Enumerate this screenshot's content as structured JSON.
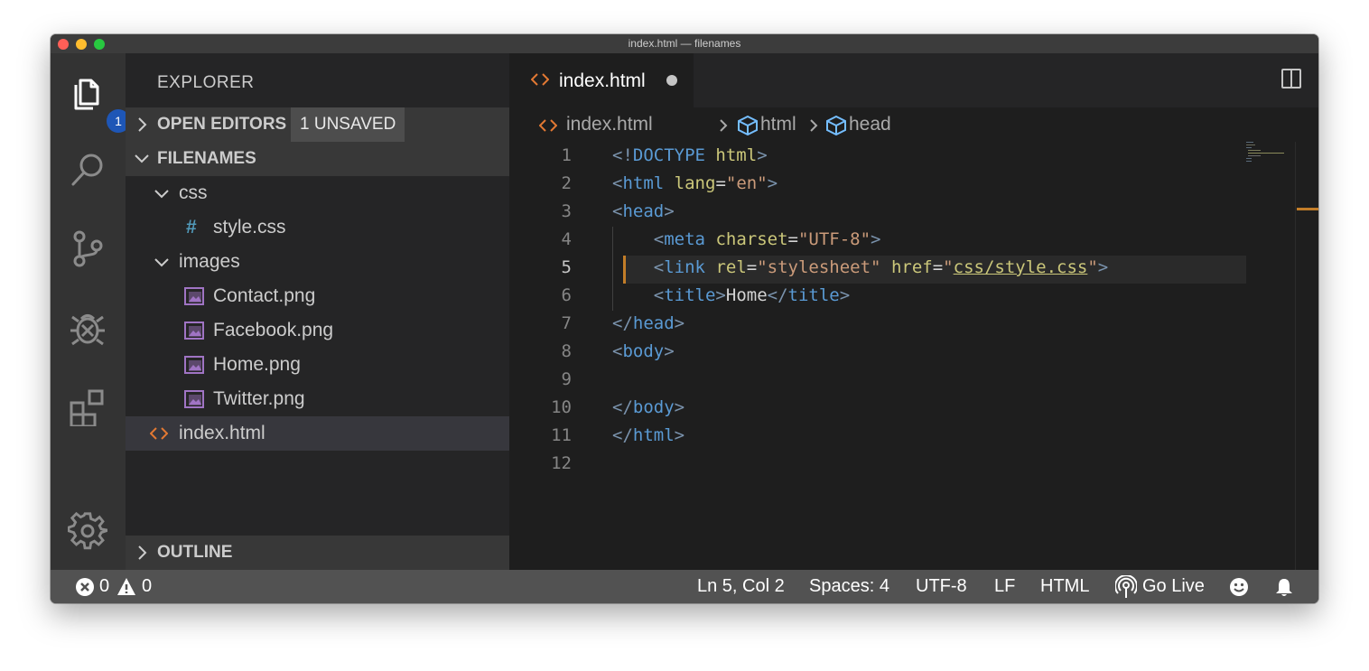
{
  "window": {
    "title": "index.html — filenames"
  },
  "activity_bar": {
    "badge": "1"
  },
  "sidebar": {
    "title": "EXPLORER",
    "open_editors": {
      "label": "OPEN EDITORS",
      "unsaved": "1 UNSAVED"
    },
    "folder": {
      "label": "FILENAMES"
    },
    "tree": [
      {
        "label": "css",
        "type": "folder"
      },
      {
        "label": "style.css",
        "type": "css",
        "icon_glyph": "#"
      },
      {
        "label": "images",
        "type": "folder"
      },
      {
        "label": "Contact.png",
        "type": "image"
      },
      {
        "label": "Facebook.png",
        "type": "image"
      },
      {
        "label": "Home.png",
        "type": "image"
      },
      {
        "label": "Twitter.png",
        "type": "image"
      },
      {
        "label": "index.html",
        "type": "html",
        "selected": true
      }
    ],
    "outline": {
      "label": "OUTLINE"
    }
  },
  "editor": {
    "tab": {
      "label": "index.html",
      "dirty": true
    },
    "breadcrumbs": [
      "index.html",
      "html",
      "head"
    ],
    "lines": [
      {
        "n": "1",
        "indent": "",
        "tokens": [
          {
            "t": "<!",
            "c": "tg"
          },
          {
            "t": "DOCTYPE",
            "c": "tn"
          },
          {
            "t": " ",
            "c": "pl"
          },
          {
            "t": "html",
            "c": "at"
          },
          {
            "t": ">",
            "c": "tg"
          }
        ]
      },
      {
        "n": "2",
        "indent": "",
        "tokens": [
          {
            "t": "<",
            "c": "tg"
          },
          {
            "t": "html",
            "c": "tn"
          },
          {
            "t": " ",
            "c": "pl"
          },
          {
            "t": "lang",
            "c": "at"
          },
          {
            "t": "=",
            "c": "pl"
          },
          {
            "t": "\"en\"",
            "c": "av"
          },
          {
            "t": ">",
            "c": "tg"
          }
        ]
      },
      {
        "n": "3",
        "indent": "",
        "tokens": [
          {
            "t": "<",
            "c": "tg"
          },
          {
            "t": "head",
            "c": "tn"
          },
          {
            "t": ">",
            "c": "tg"
          }
        ]
      },
      {
        "n": "4",
        "indent": "    ",
        "tokens": [
          {
            "t": "<",
            "c": "tg"
          },
          {
            "t": "meta",
            "c": "tn"
          },
          {
            "t": " ",
            "c": "pl"
          },
          {
            "t": "charset",
            "c": "at"
          },
          {
            "t": "=",
            "c": "pl"
          },
          {
            "t": "\"UTF-8\"",
            "c": "av"
          },
          {
            "t": ">",
            "c": "tg"
          }
        ]
      },
      {
        "n": "5",
        "indent": "    ",
        "tokens": [
          {
            "t": "<",
            "c": "tg"
          },
          {
            "t": "link",
            "c": "tn"
          },
          {
            "t": " ",
            "c": "pl"
          },
          {
            "t": "rel",
            "c": "at"
          },
          {
            "t": "=",
            "c": "pl"
          },
          {
            "t": "\"stylesheet\"",
            "c": "av"
          },
          {
            "t": " ",
            "c": "pl"
          },
          {
            "t": "href",
            "c": "at"
          },
          {
            "t": "=",
            "c": "pl"
          },
          {
            "t": "\"",
            "c": "av"
          },
          {
            "t": "css/style.css",
            "c": "lnk"
          },
          {
            "t": "\"",
            "c": "av"
          },
          {
            "t": ">",
            "c": "tg"
          }
        ]
      },
      {
        "n": "6",
        "indent": "    ",
        "tokens": [
          {
            "t": "<",
            "c": "tg"
          },
          {
            "t": "title",
            "c": "tn"
          },
          {
            "t": ">",
            "c": "tg"
          },
          {
            "t": "Home",
            "c": "pl"
          },
          {
            "t": "</",
            "c": "tg"
          },
          {
            "t": "title",
            "c": "tn"
          },
          {
            "t": ">",
            "c": "tg"
          }
        ]
      },
      {
        "n": "7",
        "indent": "",
        "tokens": [
          {
            "t": "</",
            "c": "tg"
          },
          {
            "t": "head",
            "c": "tn"
          },
          {
            "t": ">",
            "c": "tg"
          }
        ]
      },
      {
        "n": "8",
        "indent": "",
        "tokens": [
          {
            "t": "<",
            "c": "tg"
          },
          {
            "t": "body",
            "c": "tn"
          },
          {
            "t": ">",
            "c": "tg"
          }
        ]
      },
      {
        "n": "9",
        "indent": "",
        "tokens": []
      },
      {
        "n": "10",
        "indent": "",
        "tokens": [
          {
            "t": "</",
            "c": "tg"
          },
          {
            "t": "body",
            "c": "tn"
          },
          {
            "t": ">",
            "c": "tg"
          }
        ]
      },
      {
        "n": "11",
        "indent": "",
        "tokens": [
          {
            "t": "</",
            "c": "tg"
          },
          {
            "t": "html",
            "c": "tn"
          },
          {
            "t": ">",
            "c": "tg"
          }
        ]
      },
      {
        "n": "12",
        "indent": "",
        "tokens": []
      }
    ],
    "current_line": "5"
  },
  "statusbar": {
    "errors": "0",
    "warnings": "0",
    "position": "Ln 5, Col 2",
    "spaces": "Spaces: 4",
    "encoding": "UTF-8",
    "eol": "LF",
    "language": "HTML",
    "go_live": "Go Live"
  },
  "colors": {
    "accent_orange": "#c27d28",
    "badge_blue": "#1e56b6",
    "tag": "#7a93ad",
    "tag_name": "#5a9ad4",
    "attribute": "#cbc77a",
    "attr_value": "#cb9b7a",
    "image_icon": "#a074c4",
    "css_icon": "#519aba"
  },
  "icons": [
    "files-icon",
    "search-icon",
    "source-control-icon",
    "debug-icon",
    "extensions-icon",
    "gear-icon",
    "split-editor-icon",
    "more-actions-icon",
    "error-icon",
    "warning-icon",
    "broadcast-icon",
    "smiley-icon",
    "bell-icon"
  ]
}
